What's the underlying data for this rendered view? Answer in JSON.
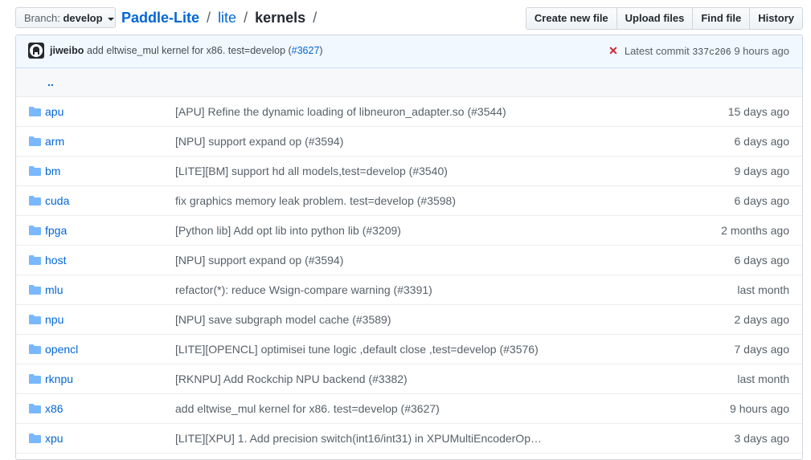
{
  "branch": {
    "label": "Branch:",
    "name": "develop"
  },
  "breadcrumb": {
    "repo": "Paddle-Lite",
    "sep": "/",
    "segment": "lite",
    "current": "kernels"
  },
  "actions": {
    "create": "Create new file",
    "upload": "Upload files",
    "find": "Find file",
    "history": "History"
  },
  "commit": {
    "author": "jiweibo",
    "message": "add eltwise_mul kernel for x86. test=develop (",
    "pr": "#3627",
    "close": ")",
    "status_icon": "x-icon",
    "latest_label": "Latest commit",
    "sha": "337c206",
    "time": "9 hours ago"
  },
  "parent_dir": "..",
  "files": [
    {
      "name": "apu",
      "message": "[APU] Refine the dynamic loading of libneuron_adapter.so (#3544)",
      "age": "15 days ago"
    },
    {
      "name": "arm",
      "message": "[NPU] support expand op (#3594)",
      "age": "6 days ago"
    },
    {
      "name": "bm",
      "message": "[LITE][BM] support hd all models,test=develop (#3540)",
      "age": "9 days ago"
    },
    {
      "name": "cuda",
      "message": "fix graphics memory leak problem. test=develop (#3598)",
      "age": "6 days ago"
    },
    {
      "name": "fpga",
      "message": "[Python lib] Add opt lib into python lib (#3209)",
      "age": "2 months ago"
    },
    {
      "name": "host",
      "message": "[NPU] support expand op (#3594)",
      "age": "6 days ago"
    },
    {
      "name": "mlu",
      "message": "refactor(*): reduce Wsign-compare warning (#3391)",
      "age": "last month"
    },
    {
      "name": "npu",
      "message": "[NPU] save subgraph model cache (#3589)",
      "age": "2 days ago"
    },
    {
      "name": "opencl",
      "message": "[LITE][OPENCL] optimisei tune logic ,default close ,test=develop (#3576)",
      "age": "7 days ago"
    },
    {
      "name": "rknpu",
      "message": "[RKNPU] Add Rockchip NPU backend (#3382)",
      "age": "last month"
    },
    {
      "name": "x86",
      "message": "add eltwise_mul kernel for x86. test=develop (#3627)",
      "age": "9 hours ago"
    },
    {
      "name": "xpu",
      "message": "[LITE][XPU] 1. Add precision switch(int16/int31) in XPUMultiEncoderOp…",
      "age": "3 days ago"
    }
  ],
  "colors": {
    "link": "#0366d6",
    "muted": "#586069",
    "error": "#cb2431",
    "commit_bg": "#f1f8ff",
    "folder": "#79b8ff"
  }
}
